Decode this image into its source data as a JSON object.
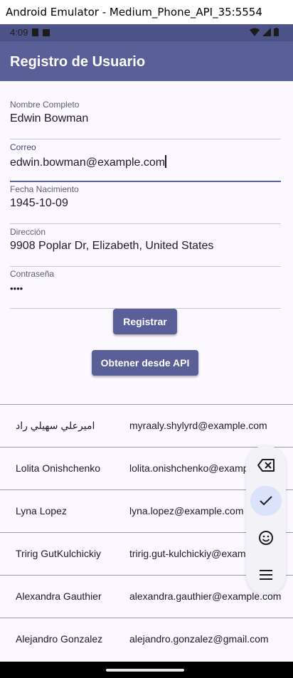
{
  "window": {
    "title": "Android Emulator - Medium_Phone_API_35:5554"
  },
  "status_bar": {
    "time": "4:09"
  },
  "app_bar": {
    "title": "Registro de Usuario"
  },
  "form": {
    "fields": [
      {
        "label": "Nombre Completo",
        "value": "Edwin Bowman"
      },
      {
        "label": "Correo",
        "value": "edwin.bowman@example.com"
      },
      {
        "label": "Fecha Nacimiento",
        "value": "1945-10-09"
      },
      {
        "label": "Dirección",
        "value": "9908 Poplar Dr, Elizabeth, United States"
      },
      {
        "label": "Contraseña",
        "value": "••••"
      }
    ],
    "register_label": "Registrar",
    "fetch_label": "Obtener desde API"
  },
  "users": [
    {
      "name": "اميرعلي سهيلي راد",
      "email": "myraaly.shylyrd@example.com"
    },
    {
      "name": "Lolita Onishchenko",
      "email": "lolita.onishchenko@example.com"
    },
    {
      "name": "Lyna Lopez",
      "email": "lyna.lopez@example.com"
    },
    {
      "name": "Tririg GutKulchickiy",
      "email": "tririg.gut-kulchickiy@example.com"
    },
    {
      "name": "Alexandra Gauthier",
      "email": "alexandra.gauthier@example.com"
    },
    {
      "name": "Alejandro Gonzalez",
      "email": "alejandro.gonzalez@gmail.com"
    }
  ],
  "keyboard_toolbar": {
    "icons": [
      "backspace-icon",
      "check-icon",
      "emoji-icon",
      "menu-icon"
    ]
  },
  "colors": {
    "primary": "#5a5f98",
    "background": "#fbf8ff"
  }
}
